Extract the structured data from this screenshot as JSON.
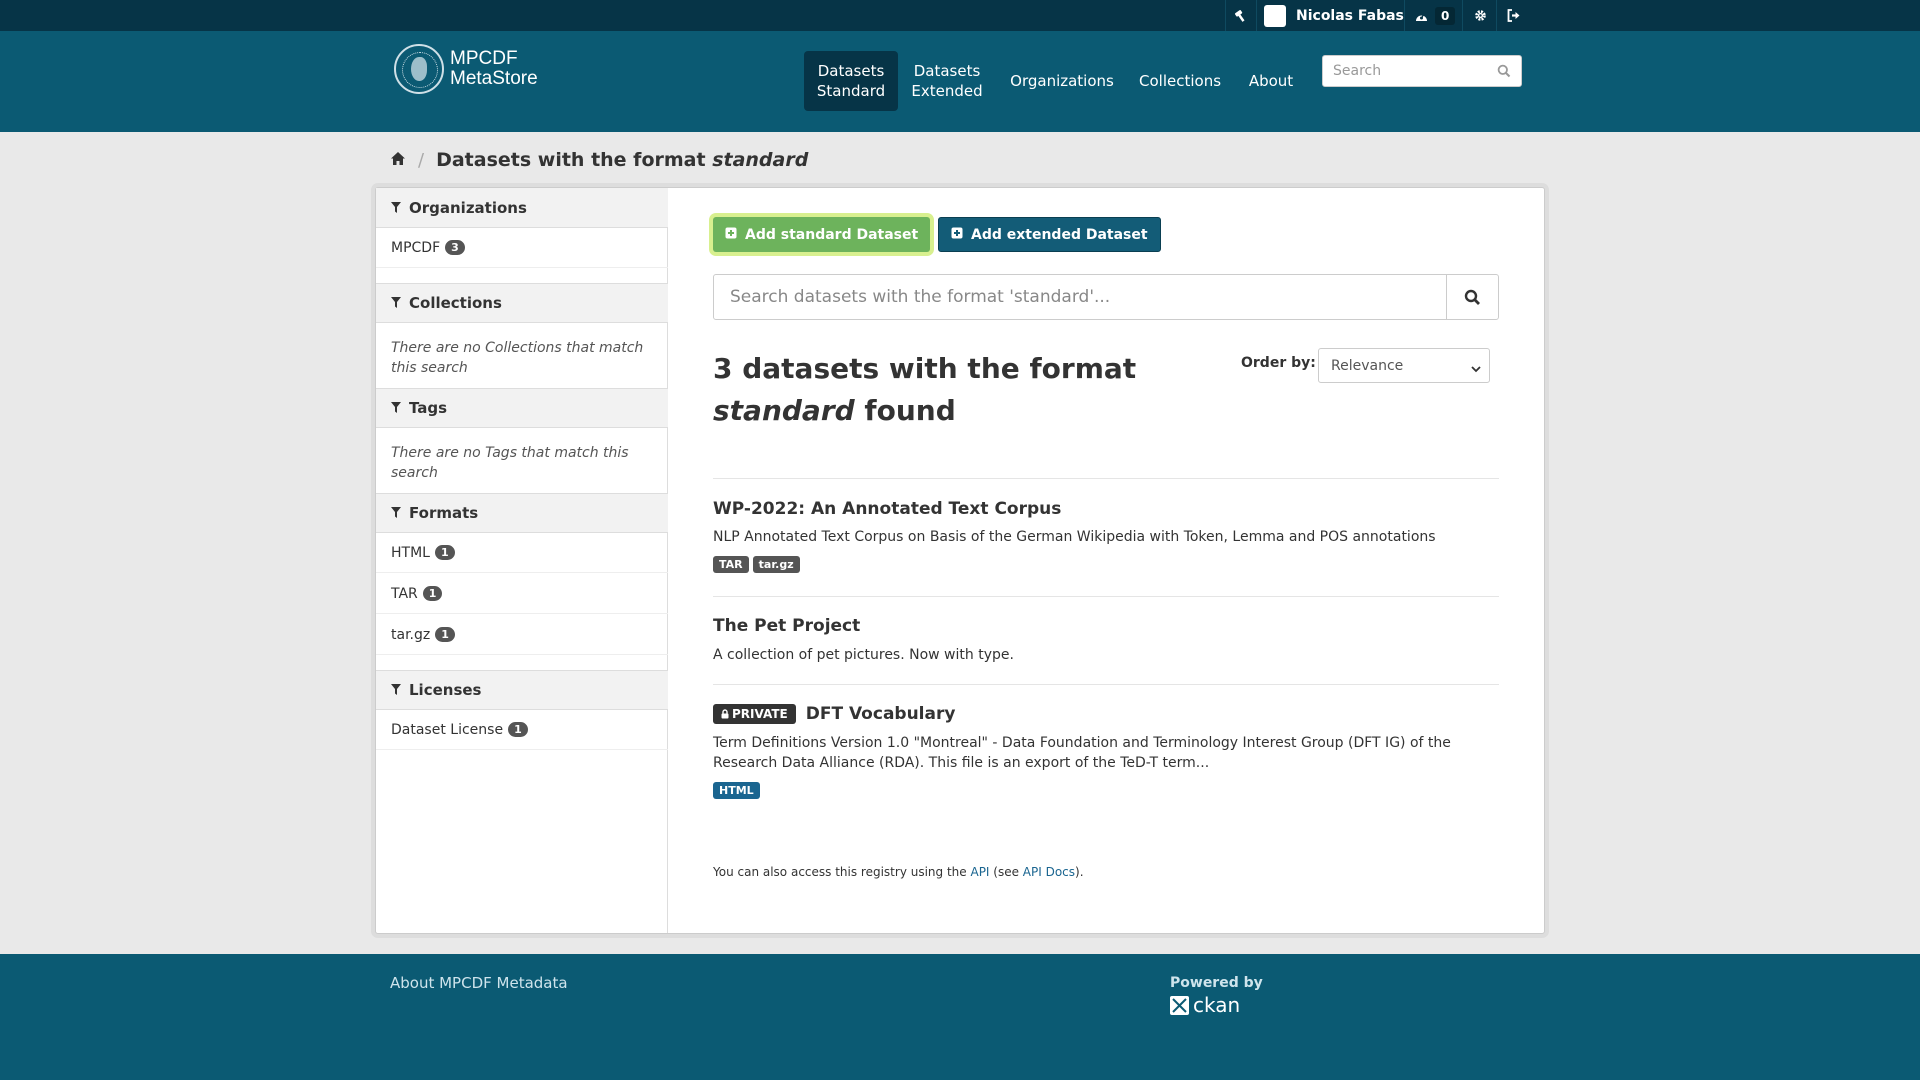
{
  "account": {
    "user_name": "Nicolas Fabas",
    "activity_count": "0"
  },
  "brand": {
    "logo_line1": "MPCDF",
    "logo_line2": "MetaStore"
  },
  "nav": {
    "items": [
      {
        "line1": "Datasets",
        "line2": "Standard"
      },
      {
        "line1": "Datasets",
        "line2": "Extended"
      },
      {
        "line1": "Organizations"
      },
      {
        "line1": "Collections"
      },
      {
        "line1": "About"
      }
    ],
    "search_placeholder": "Search"
  },
  "breadcrumb": {
    "prefix": "Datasets with the format ",
    "format": "standard"
  },
  "facets": {
    "organizations": {
      "title": "Organizations",
      "items": [
        {
          "name": "MPCDF",
          "count": "3"
        }
      ]
    },
    "collections": {
      "title": "Collections",
      "empty": "There are no Collections that match this search"
    },
    "tags": {
      "title": "Tags",
      "empty": "There are no Tags that match this search"
    },
    "formats": {
      "title": "Formats",
      "items": [
        {
          "name": "HTML",
          "count": "1"
        },
        {
          "name": "TAR",
          "count": "1"
        },
        {
          "name": "tar.gz",
          "count": "1"
        }
      ]
    },
    "licenses": {
      "title": "Licenses",
      "items": [
        {
          "name": "Dataset License",
          "count": "1"
        }
      ]
    }
  },
  "actions": {
    "add_standard": "Add standard Dataset",
    "add_extended": "Add extended Dataset"
  },
  "search": {
    "placeholder": "Search datasets with the format 'standard'..."
  },
  "results": {
    "count_line1": "3 datasets with the format",
    "count_format": "standard",
    "count_suffix": " found",
    "order_label": "Order by:",
    "order_value": "Relevance"
  },
  "datasets": [
    {
      "title": "WP-2022: An Annotated Text Corpus",
      "notes": "NLP Annotated Text Corpus on Basis of the German Wikipedia with Token, Lemma and POS annotations",
      "formats": [
        "TAR",
        "tar.gz"
      ]
    },
    {
      "title": "The Pet Project",
      "notes": "A collection of pet pictures. Now with type.",
      "formats": []
    },
    {
      "private_label": "PRIVATE",
      "title": "DFT Vocabulary",
      "notes_line1": "Term Definitions Version 1.0 \"Montreal\" - Data Foundation and Terminology Interest Group (DFT IG) of the",
      "notes_line2": "Research Data Alliance (RDA). This file is an export of the TeD-T term...",
      "formats": [
        "HTML"
      ]
    }
  ],
  "api_note": {
    "before": "You can also access this registry using the ",
    "api_link": "API",
    "middle": " (see ",
    "docs_link": "API Docs",
    "after": ")."
  },
  "footer": {
    "about": "About MPCDF Metadata",
    "powered_by": "Powered by",
    "ckan": "ckan"
  }
}
